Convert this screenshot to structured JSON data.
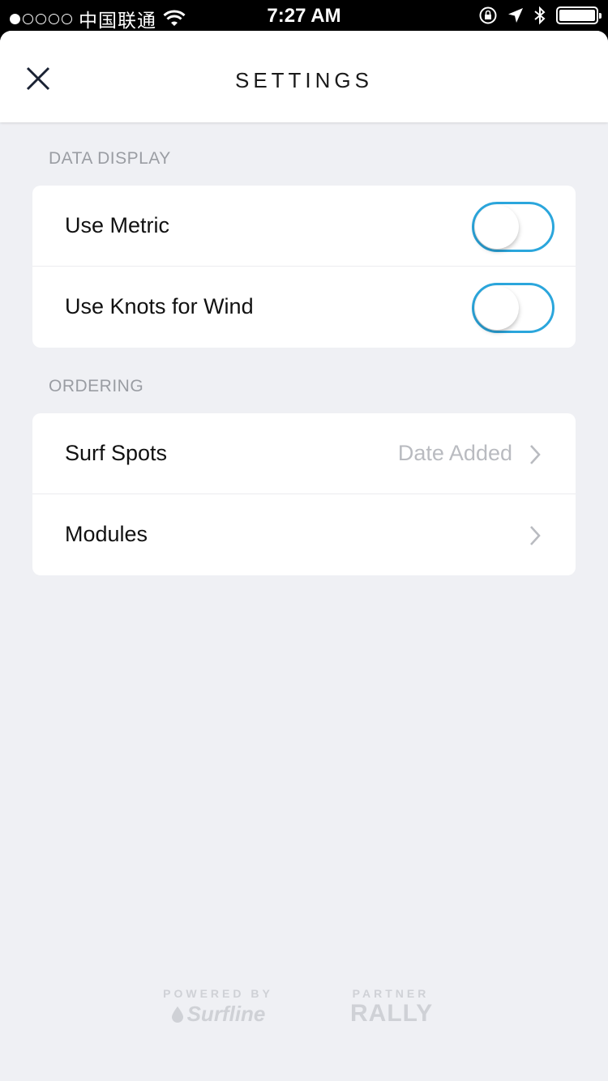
{
  "status_bar": {
    "carrier": "中国联通",
    "time": "7:27 AM",
    "signal_dots": 5,
    "signal_filled": 1
  },
  "nav": {
    "title": "SETTINGS",
    "close_icon": "close-icon"
  },
  "sections": {
    "data_display": {
      "header": "DATA DISPLAY",
      "rows": [
        {
          "label": "Use Metric",
          "toggle_on": false
        },
        {
          "label": "Use Knots for Wind",
          "toggle_on": false
        }
      ]
    },
    "ordering": {
      "header": "ORDERING",
      "rows": [
        {
          "label": "Surf Spots",
          "value": "Date Added"
        },
        {
          "label": "Modules",
          "value": ""
        }
      ]
    }
  },
  "footer": {
    "powered_by": "POWERED BY",
    "surfline": "Surfline",
    "partner": "PARTNER",
    "rally": "RALLY"
  },
  "colors": {
    "accent": "#2ba6dc",
    "background": "#eff0f4",
    "muted_text": "#9a9da3"
  }
}
